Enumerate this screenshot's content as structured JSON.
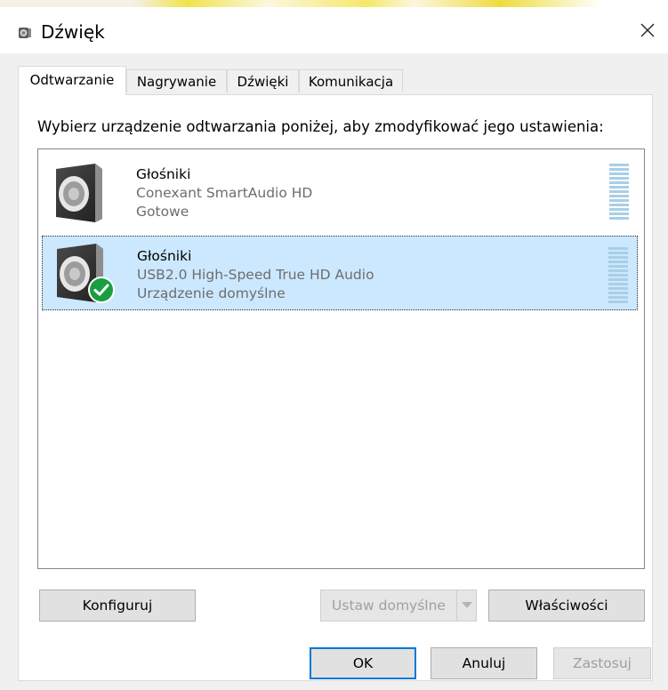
{
  "window": {
    "title": "Dźwięk",
    "icon": "speaker-icon"
  },
  "tabs": [
    {
      "label": "Odtwarzanie",
      "active": true
    },
    {
      "label": "Nagrywanie",
      "active": false
    },
    {
      "label": "Dźwięki",
      "active": false
    },
    {
      "label": "Komunikacja",
      "active": false
    }
  ],
  "instruction": "Wybierz urządzenie odtwarzania poniżej, aby zmodyfikować jego ustawienia:",
  "devices": [
    {
      "name": "Głośniki",
      "driver": "Conexant SmartAudio HD",
      "status": "Gotowe",
      "selected": false,
      "is_default": false
    },
    {
      "name": "Głośniki",
      "driver": "USB2.0 High-Speed True HD Audio",
      "status": "Urządzenie domyślne",
      "selected": true,
      "is_default": true
    }
  ],
  "panel_buttons": {
    "configure": "Konfiguruj",
    "set_default": "Ustaw domyślne",
    "properties": "Właściwości"
  },
  "dialog_buttons": {
    "ok": "OK",
    "cancel": "Anuluj",
    "apply": "Zastosuj"
  },
  "colors": {
    "selection": "#cce8ff",
    "accent": "#0078d7",
    "check_badge": "#1a9e3f",
    "meter": "#a9cfe6"
  }
}
